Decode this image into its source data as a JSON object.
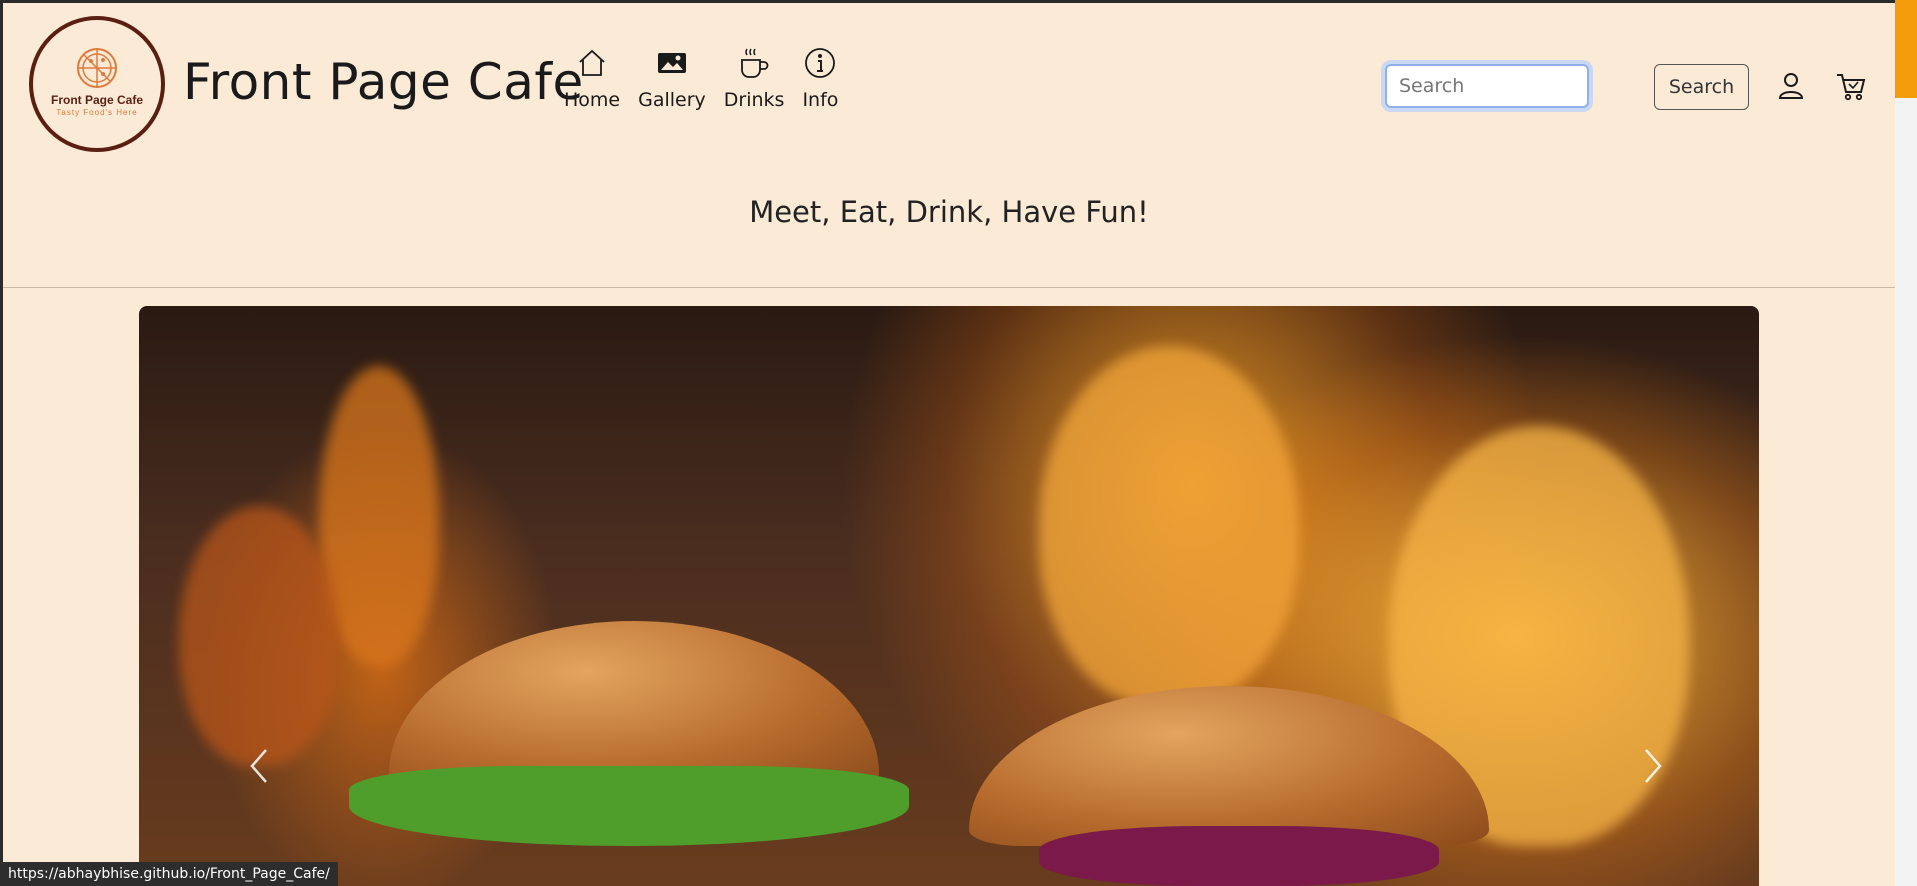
{
  "brand": {
    "logo_name": "Front Page Cafe",
    "logo_tagline": "Tasty Food's Here",
    "title": "Front Page Cafe"
  },
  "nav": {
    "items": [
      {
        "label": "Home",
        "icon": "home-icon"
      },
      {
        "label": "Gallery",
        "icon": "image-icon"
      },
      {
        "label": "Drinks",
        "icon": "cup-icon"
      },
      {
        "label": "Info",
        "icon": "info-icon"
      }
    ]
  },
  "search": {
    "placeholder": "Search",
    "value": "",
    "button_label": "Search"
  },
  "icons": {
    "user": "person-icon",
    "cart": "cart-icon"
  },
  "tagline": "Meet, Eat, Drink, Have Fun!",
  "carousel": {
    "slide_description": "burgers-with-flames",
    "prev_icon": "chevron-left-icon",
    "next_icon": "chevron-right-icon"
  },
  "status_url": "https://abhaybhise.github.io/Front_Page_Cafe/",
  "colors": {
    "page_background": "#fbead6",
    "scrollbar_thumb": "#f59c0b",
    "logo_ring": "#5a1f12",
    "logo_accent": "#e07a3c"
  }
}
